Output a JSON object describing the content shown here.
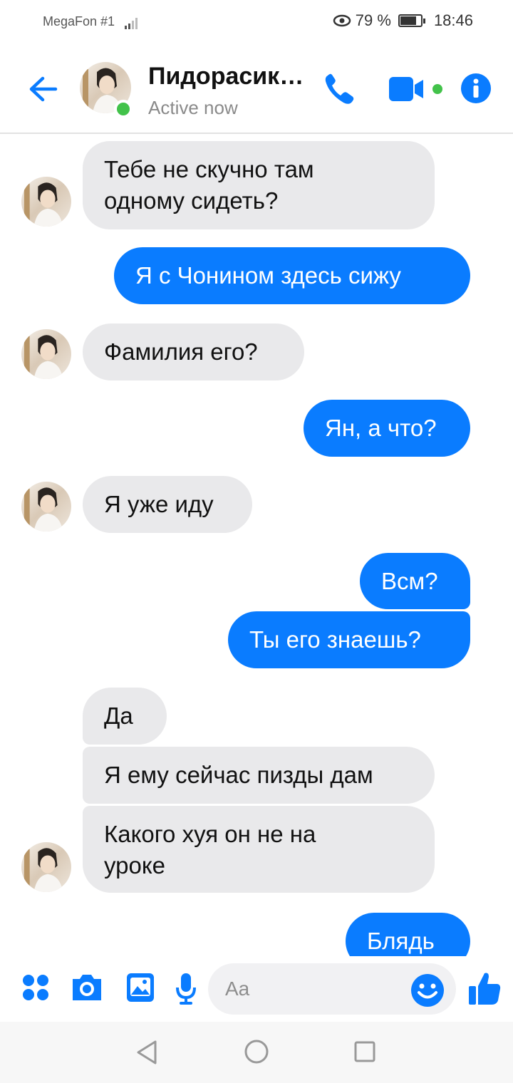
{
  "status_bar": {
    "carrier": "MegaFon #1",
    "battery": "79 %",
    "battery_level": 0.79,
    "time": "18:46",
    "icons": [
      "signal-icon",
      "eye-icon",
      "battery-icon"
    ]
  },
  "header": {
    "name": "Пидорасик…",
    "status": "Active now",
    "icons": [
      "back-arrow-icon",
      "phone-icon",
      "video-camera-icon",
      "info-icon"
    ],
    "accent": "#0a7cff",
    "online_color": "#42c24a"
  },
  "messages": [
    {
      "from": "them",
      "lines": [
        "Тебе не скучно там",
        "одному сидеть?"
      ]
    },
    {
      "from": "me",
      "text": "Я с Чонином  здесь сижу"
    },
    {
      "from": "them",
      "text": "Фамилия его?"
    },
    {
      "from": "me",
      "text": "Ян, а что?"
    },
    {
      "from": "them",
      "text": "Я уже иду"
    },
    {
      "from": "me",
      "text": "Всм?"
    },
    {
      "from": "me",
      "text": "Ты его знаешь?"
    },
    {
      "from": "them",
      "text": "Да"
    },
    {
      "from": "them",
      "text": "Я ему сейчас пизды дам"
    },
    {
      "from": "them",
      "lines": [
        "Какого хуя он не на",
        "уроке"
      ]
    },
    {
      "from": "me",
      "text": "Блядь"
    }
  ],
  "composer": {
    "placeholder": "Aa",
    "icons": [
      "apps-grid-icon",
      "camera-icon",
      "image-icon",
      "microphone-icon",
      "emoji-icon",
      "thumbs-up-icon"
    ]
  },
  "nav": {
    "icons": [
      "back-triangle-icon",
      "home-circle-icon",
      "recents-square-icon"
    ]
  }
}
